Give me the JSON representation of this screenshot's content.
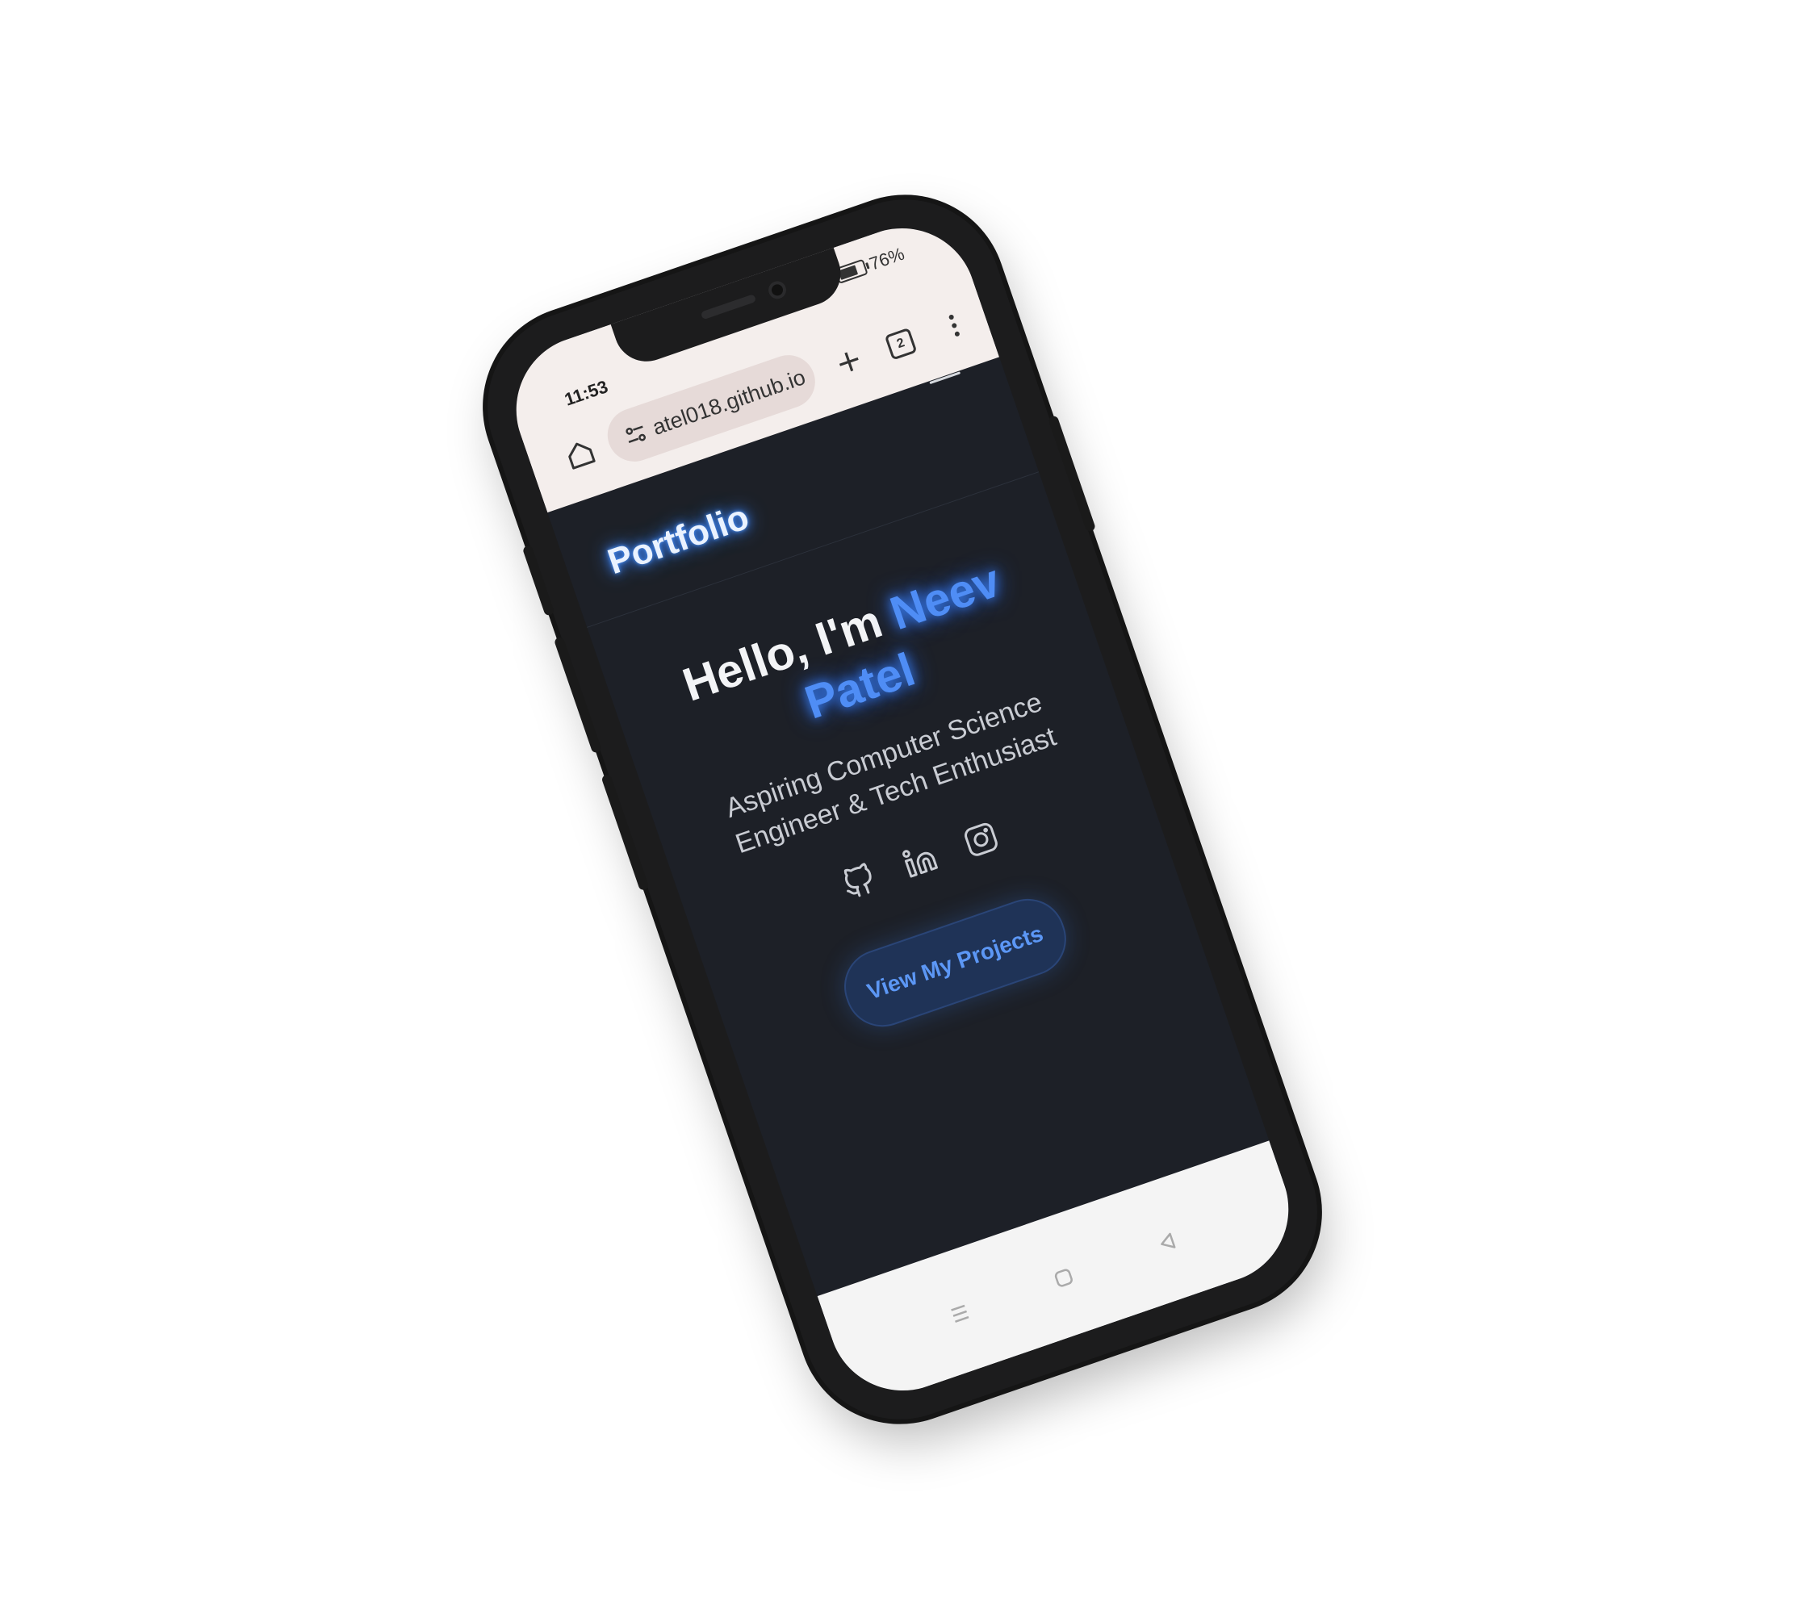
{
  "status_bar": {
    "time": "11:53",
    "battery_text": "76%",
    "battery_level": 0.76
  },
  "browser": {
    "url": "atel018.github.io",
    "tab_count": "2",
    "home_icon": "home-icon",
    "site_settings_icon": "tune-icon",
    "new_tab_icon": "plus-icon",
    "menu_icon": "more-vertical-icon"
  },
  "site": {
    "brand": "Portfolio",
    "menu_icon": "hamburger-icon"
  },
  "hero": {
    "greeting": "Hello, I'm ",
    "name": "Neev Patel",
    "subtitle": "Aspiring Computer Science Engineer & Tech Enthusiast",
    "socials": [
      {
        "icon": "github-icon"
      },
      {
        "icon": "linkedin-icon"
      },
      {
        "icon": "instagram-icon"
      }
    ],
    "cta_label": "View My Projects"
  },
  "system_nav": {
    "recent_icon": "recent-apps-icon",
    "home_icon": "home-circle-icon",
    "back_icon": "back-triangle-icon"
  },
  "colors": {
    "page_bg": "#1d2027",
    "accent": "#4f8df5",
    "chrome_bg": "#f4eeec",
    "phone_frame": "#1c1c1d"
  }
}
